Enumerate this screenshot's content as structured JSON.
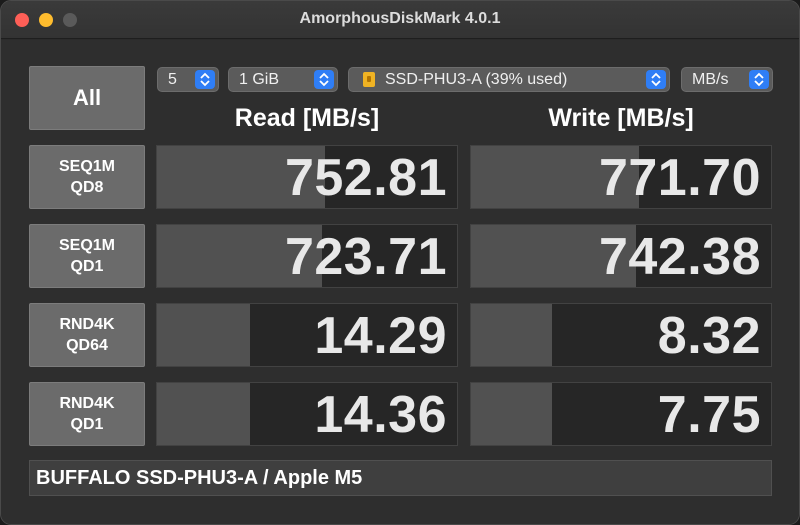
{
  "window": {
    "title": "AmorphousDiskMark 4.0.1"
  },
  "controls": {
    "all_label": "All",
    "count": "5",
    "size": "1 GiB",
    "drive": "SSD-PHU3-A (39% used)",
    "unit": "MB/s"
  },
  "columns": {
    "read": "Read [MB/s]",
    "write": "Write [MB/s]"
  },
  "tests": [
    {
      "line1": "SEQ1M",
      "line2": "QD8",
      "read": "752.81",
      "write": "771.70",
      "read_level": 0.56,
      "write_level": 0.56
    },
    {
      "line1": "SEQ1M",
      "line2": "QD1",
      "read": "723.71",
      "write": "742.38",
      "read_level": 0.55,
      "write_level": 0.55
    },
    {
      "line1": "RND4K",
      "line2": "QD64",
      "read": "14.29",
      "write": "8.32",
      "read_level": 0.31,
      "write_level": 0.27
    },
    {
      "line1": "RND4K",
      "line2": "QD1",
      "read": "14.36",
      "write": "7.75",
      "read_level": 0.31,
      "write_level": 0.27
    }
  ],
  "status": "BUFFALO SSD-PHU3-A / Apple M5"
}
